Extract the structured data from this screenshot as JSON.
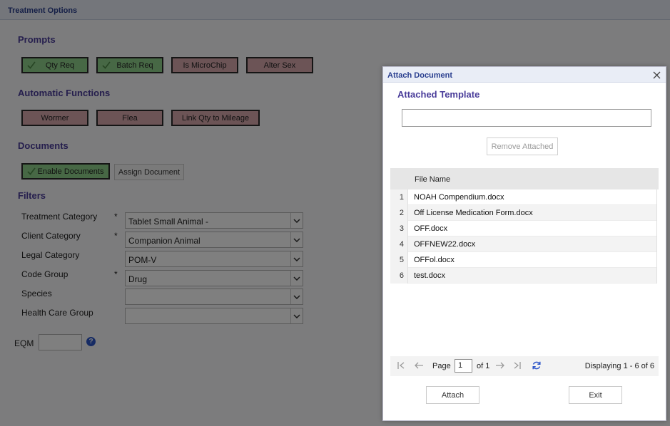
{
  "window": {
    "title": "Treatment Options"
  },
  "sections": {
    "prompts": "Prompts",
    "automatic_functions": "Automatic Functions",
    "documents": "Documents",
    "filters": "Filters"
  },
  "prompts": {
    "qty_req": "Qty Req",
    "batch_req": "Batch Req",
    "is_microchip": "Is MicroChip",
    "alter_sex": "Alter Sex"
  },
  "automatic": {
    "wormer": "Wormer",
    "flea": "Flea",
    "link_qty": "Link Qty to Mileage"
  },
  "documents": {
    "enable": "Enable Documents",
    "assign": "Assign Document"
  },
  "filters": {
    "required_mark": "*",
    "treatment_category": {
      "label": "Treatment Category",
      "value": "Tablet Small Animal -"
    },
    "client_category": {
      "label": "Client Category",
      "value": "Companion Animal"
    },
    "legal_category": {
      "label": "Legal Category",
      "value": "POM-V"
    },
    "code_group": {
      "label": "Code Group",
      "value": "Drug"
    },
    "species": {
      "label": "Species",
      "value": ""
    },
    "health_care_group": {
      "label": "Health Care Group",
      "value": ""
    }
  },
  "eqm": {
    "label": "EQM",
    "value": ""
  },
  "dialog": {
    "title": "Attach Document",
    "subtitle": "Attached Template",
    "template_value": "",
    "remove_label": "Remove Attached",
    "column_header": "File Name",
    "files": [
      {
        "num": "1",
        "name": "NOAH Compendium.docx"
      },
      {
        "num": "2",
        "name": "Off License Medication Form.docx"
      },
      {
        "num": "3",
        "name": "OFF.docx"
      },
      {
        "num": "4",
        "name": "OFFNEW22.docx"
      },
      {
        "num": "5",
        "name": "OFFol.docx"
      },
      {
        "num": "6",
        "name": "test.docx"
      }
    ],
    "pager": {
      "page_label": "Page",
      "page_value": "1",
      "of_label": "of 1",
      "display_text": "Displaying 1 - 6 of 6"
    },
    "attach_label": "Attach",
    "exit_label": "Exit"
  },
  "colors": {
    "accent": "#4a3d9a",
    "toggle_on": "#8fd08a",
    "toggle_off": "#d9a9ad",
    "refresh": "#2d56c9"
  },
  "icons": [
    "check-icon",
    "chevron-down-icon",
    "help-icon",
    "close-icon",
    "first-page-icon",
    "prev-page-icon",
    "next-page-icon",
    "last-page-icon",
    "refresh-icon"
  ]
}
